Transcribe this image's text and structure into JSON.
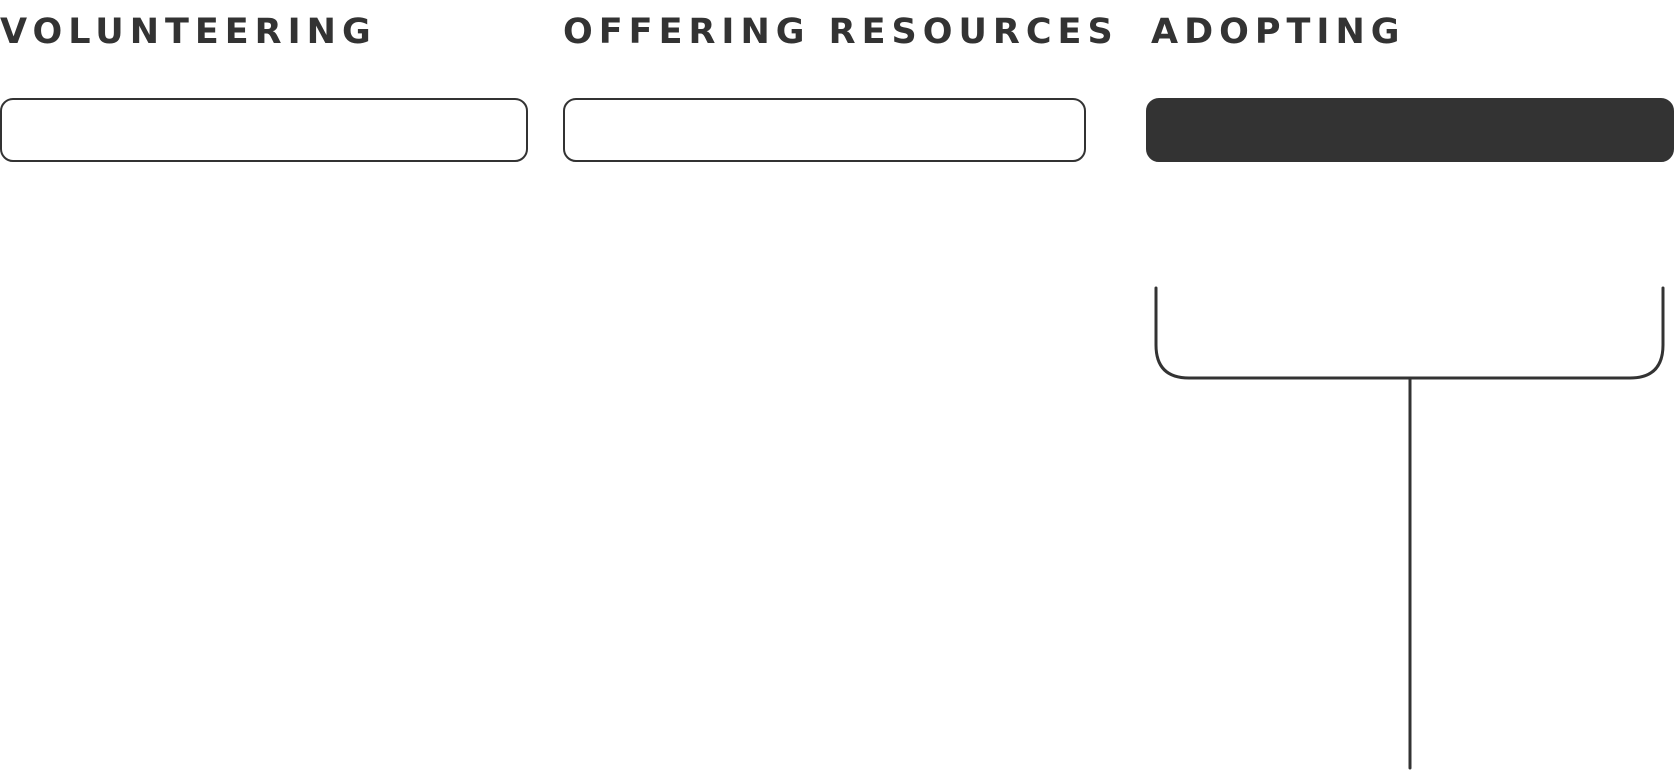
{
  "tabs": [
    {
      "label": "VOLUNTEERING",
      "selected": false
    },
    {
      "label": "OFFERING RESOURCES",
      "selected": false
    },
    {
      "label": "ADOPTING",
      "selected": true
    }
  ],
  "colors": {
    "foreground": "#333333",
    "background": "#ffffff",
    "selected_fill": "#333333"
  }
}
